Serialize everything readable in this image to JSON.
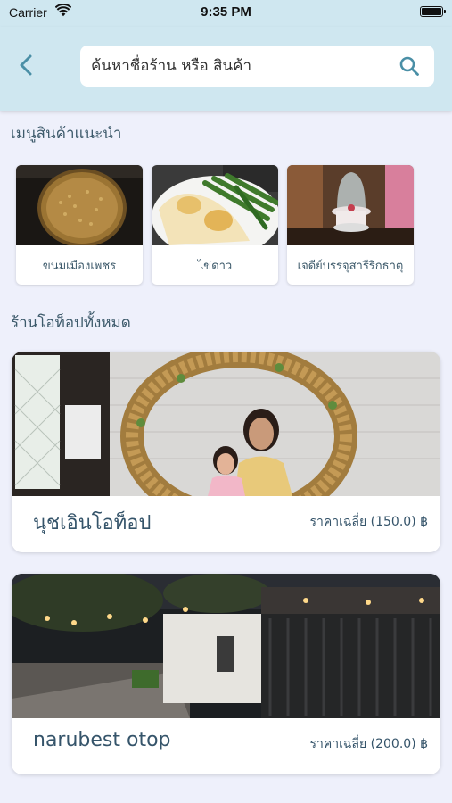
{
  "status_bar": {
    "carrier": "Carrier",
    "time": "9:35 PM"
  },
  "search": {
    "placeholder": "ค้นหาชื่อร้าน หรือ สินค้า"
  },
  "recommended": {
    "title": "เมนูสินค้าแนะนำ",
    "items": [
      {
        "label": "ขนมเมืองเพชร"
      },
      {
        "label": "ไข่ดาว"
      },
      {
        "label": "เจดีย์บรรจุสารีริกธาตุ"
      }
    ]
  },
  "shops": {
    "title": "ร้านโอท็อปทั้งหมด",
    "items": [
      {
        "name": "นุชเอินโอท็อป",
        "price": "ราคาเฉลี่ย (150.0) ฿"
      },
      {
        "name": "narubest otop",
        "price": "ราคาเฉลี่ย (200.0) ฿"
      }
    ]
  },
  "colors": {
    "header_bg": "#cfe7f0",
    "page_bg": "#eef0fb",
    "accent": "#4a8fa6"
  }
}
